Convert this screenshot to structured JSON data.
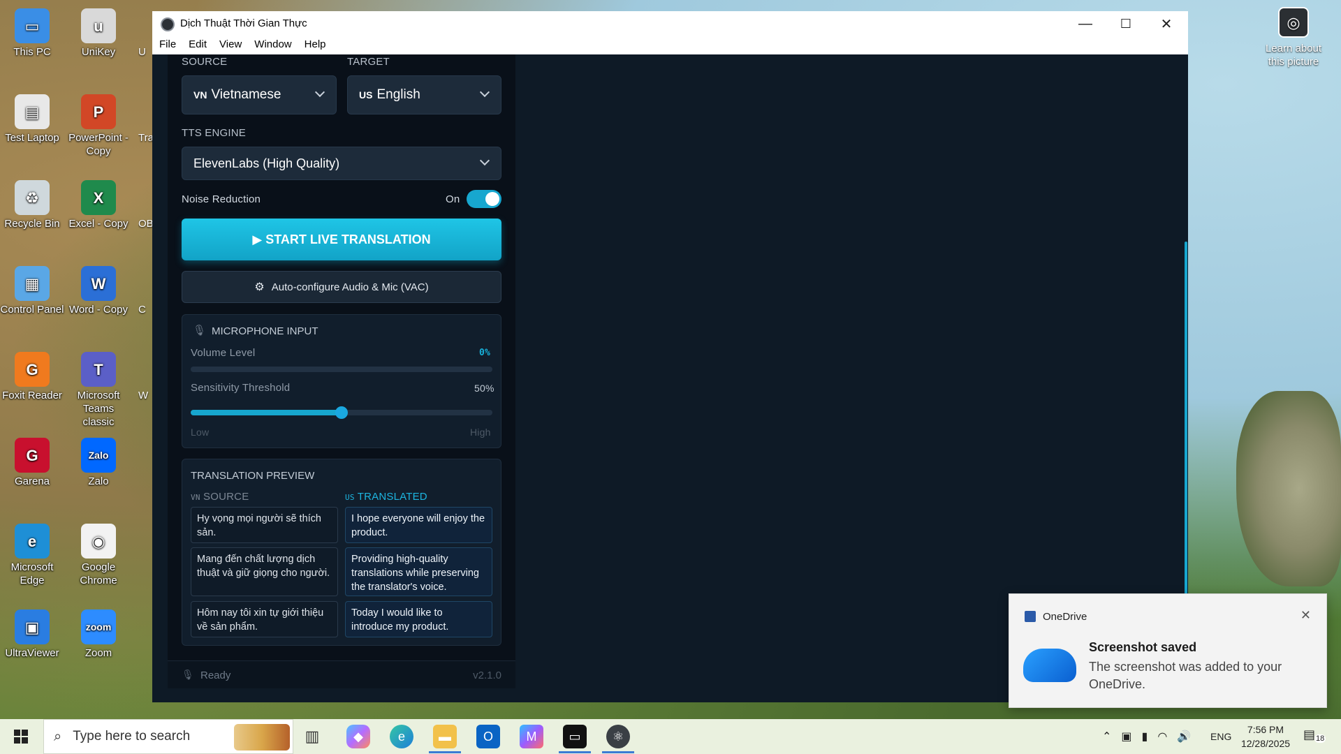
{
  "desktop": {
    "icons": [
      {
        "label": "This PC",
        "color": "#3a8ee6",
        "glyph": "▭"
      },
      {
        "label": "UniKey",
        "color": "#d9d9d9",
        "glyph": "u"
      },
      {
        "label": "Test Laptop",
        "color": "#e8e8e8",
        "glyph": "▤"
      },
      {
        "label": "PowerPoint - Copy",
        "color": "#d24726",
        "glyph": "P"
      },
      {
        "label": "Recycle Bin",
        "color": "#cfd8dc",
        "glyph": "♻"
      },
      {
        "label": "Excel - Copy",
        "color": "#1f8a4c",
        "glyph": "X"
      },
      {
        "label": "Control Panel",
        "color": "#5aa7e6",
        "glyph": "▦"
      },
      {
        "label": "Word - Copy",
        "color": "#2b6fd6",
        "glyph": "W"
      },
      {
        "label": "Foxit Reader",
        "color": "#f07a1e",
        "glyph": "G"
      },
      {
        "label": "Microsoft Teams classic",
        "color": "#5b5fc7",
        "glyph": "T"
      },
      {
        "label": "Garena",
        "color": "#c8102e",
        "glyph": "G"
      },
      {
        "label": "Zalo",
        "color": "#0068ff",
        "glyph": "Zalo"
      },
      {
        "label": "Microsoft Edge",
        "color": "#1e8fd6",
        "glyph": "e"
      },
      {
        "label": "Google Chrome",
        "color": "#f2f2f2",
        "glyph": "◉"
      },
      {
        "label": "UltraViewer",
        "color": "#2a7de1",
        "glyph": "▣"
      },
      {
        "label": "Zoom",
        "color": "#2d8cff",
        "glyph": "zoom"
      }
    ],
    "partial_labels": [
      "U",
      "Tra",
      "OB",
      "C",
      "W"
    ],
    "learn_picture": "Learn about this picture"
  },
  "window": {
    "title": "Dịch Thuật Thời Gian Thực",
    "menu": [
      "File",
      "Edit",
      "View",
      "Window",
      "Help"
    ],
    "controls": {
      "minimize": "—",
      "maximize": "☐",
      "close": "✕"
    }
  },
  "app": {
    "source_label": "SOURCE",
    "target_label": "TARGET",
    "source_lang": {
      "code": "VN",
      "name": "Vietnamese"
    },
    "target_lang": {
      "code": "US",
      "name": "English"
    },
    "tts_label": "TTS ENGINE",
    "tts_value": "ElevenLabs (High Quality)",
    "noise_label": "Noise Reduction",
    "noise_state": "On",
    "start_button": "▶ START LIVE TRANSLATION",
    "auto_button": "Auto-configure Audio & Mic (VAC)",
    "mic": {
      "title": "MICROPHONE INPUT",
      "volume_label": "Volume Level",
      "volume_value": "0%",
      "volume_fraction": 0,
      "sensitivity_label": "Sensitivity Threshold",
      "sensitivity_value": "50%",
      "sensitivity_fraction": 0.5,
      "low": "Low",
      "high": "High"
    },
    "preview": {
      "title": "TRANSLATION PREVIEW",
      "source_col": "SOURCE",
      "translated_col": "TRANSLATED",
      "source_code": "VN",
      "target_code": "US",
      "rows": [
        {
          "src": "Hy vọng mọi người sẽ thích sản.",
          "dst": "I hope everyone will enjoy the product."
        },
        {
          "src": "Mang đến chất lượng dịch thuật và giữ giọng cho người.",
          "dst": "Providing high-quality translations while preserving the translator's voice."
        },
        {
          "src": "Hôm nay tôi xin tự giới thiệu về sản phẩm.",
          "dst": "Today I would like to introduce my product."
        }
      ]
    },
    "status": "Ready",
    "version": "v2.1.0"
  },
  "toast": {
    "app": "OneDrive",
    "title": "Screenshot saved",
    "body": "The screenshot was added to your OneDrive."
  },
  "taskbar": {
    "search_placeholder": "Type here to search",
    "lang": "ENG",
    "time": "7:56 PM",
    "date": "12/28/2025",
    "notifications": "18"
  },
  "colors": {
    "accent": "#17a7cf",
    "panel": "#091019",
    "card": "#111e2c"
  }
}
